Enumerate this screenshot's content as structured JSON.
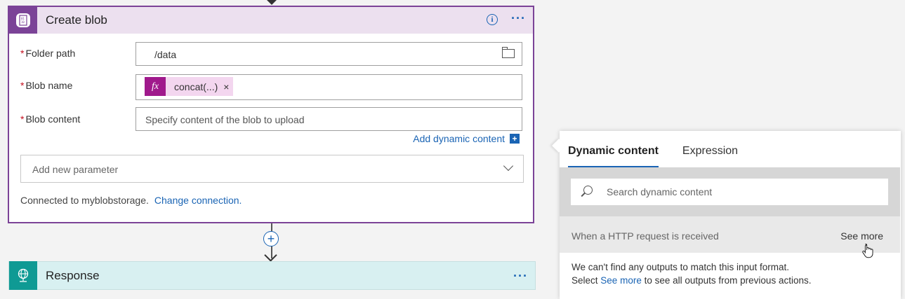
{
  "create_blob": {
    "title": "Create blob",
    "fields": {
      "folder_path": {
        "label": "Folder path",
        "value": "/data"
      },
      "blob_name": {
        "label": "Blob name",
        "token_text": "concat(...)",
        "token_remove": "×"
      },
      "blob_content": {
        "label": "Blob content",
        "placeholder": "Specify content of the blob to upload"
      }
    },
    "required_marker": "*",
    "add_dynamic_content": "Add dynamic content",
    "add_parameter_placeholder": "Add new parameter",
    "connected_text": "Connected to myblobstorage.",
    "change_connection": "Change connection."
  },
  "response": {
    "title": "Response"
  },
  "dynamic_panel": {
    "tabs": [
      {
        "label": "Dynamic content",
        "active": true
      },
      {
        "label": "Expression",
        "active": false
      }
    ],
    "search_placeholder": "Search dynamic content",
    "section_title": "When a HTTP request is received",
    "see_more": "See more",
    "message_line1": "We can't find any outputs to match this input format.",
    "message_prefix": "Select",
    "message_link": "See more",
    "message_suffix": "to see all outputs from previous actions."
  },
  "icons": {
    "create_blob_icon": "blob-storage-icon",
    "response_icon": "globe-icon",
    "info": "info-icon",
    "more": "ellipsis-icon",
    "folder": "folder-icon",
    "search": "search-icon"
  },
  "colors": {
    "create_blob_accent": "#7b4397",
    "create_blob_header_bg": "#ece0ef",
    "response_accent": "#0f9a94",
    "response_bg": "#d8f0f1",
    "link": "#1a64b4",
    "expression_token": "#a0198c"
  }
}
